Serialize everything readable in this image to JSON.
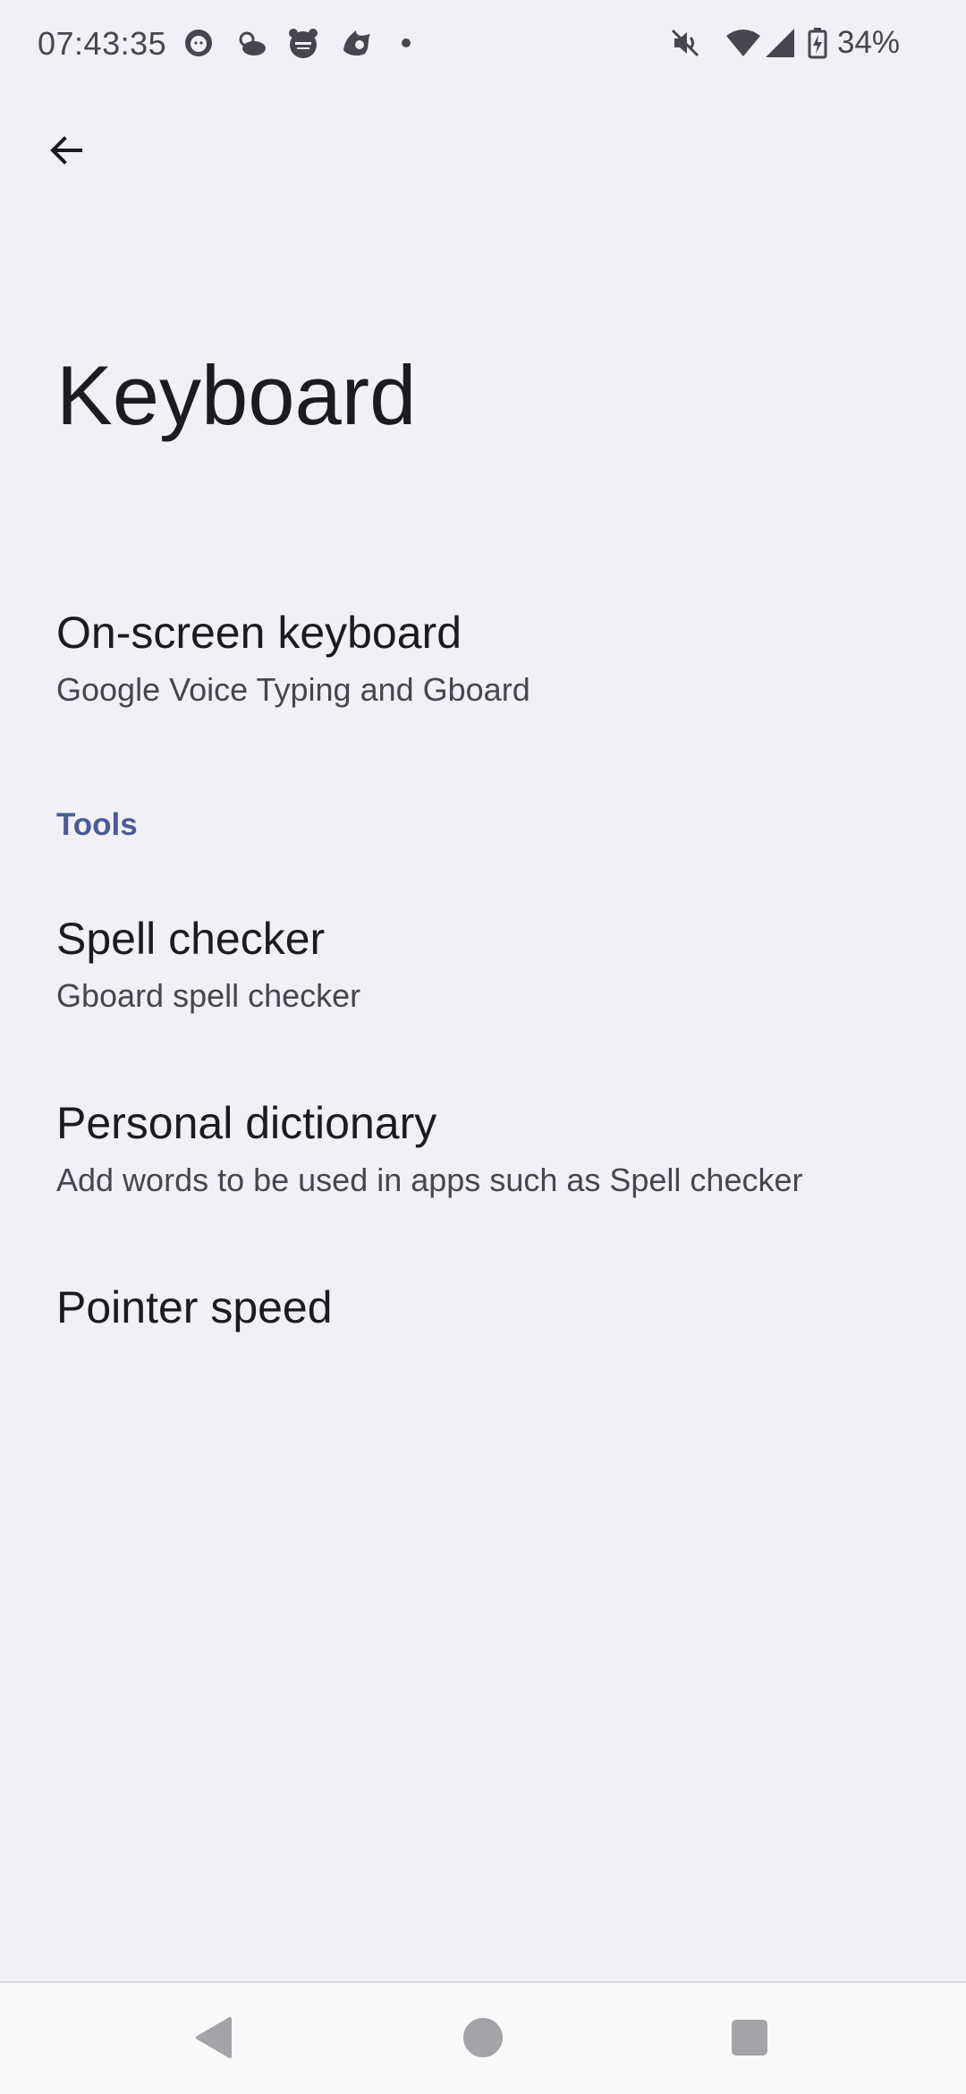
{
  "status_bar": {
    "time": "07:43:35",
    "battery_percent": "34%",
    "icons": [
      "notification-app-icon",
      "weather-icon",
      "notification-app-icon",
      "notification-app-icon",
      "more-notifications-dot-icon",
      "mute-icon",
      "wifi-icon",
      "signal-icon",
      "battery-charging-icon"
    ]
  },
  "header": {
    "back_icon": "arrow-back-icon",
    "title": "Keyboard"
  },
  "items": {
    "on_screen_keyboard": {
      "title": "On-screen keyboard",
      "summary": "Google Voice Typing and Gboard"
    },
    "tools_header": "Tools",
    "spell_checker": {
      "title": "Spell checker",
      "summary": "Gboard spell checker"
    },
    "personal_dictionary": {
      "title": "Personal dictionary",
      "summary": "Add words to be used in apps such as Spell checker"
    },
    "pointer_speed": {
      "title": "Pointer speed"
    }
  },
  "nav_bar": {
    "icons": [
      "nav-back-icon",
      "nav-home-icon",
      "nav-recents-icon"
    ]
  },
  "colors": {
    "background": "#f1f0f6",
    "accent": "#4c5c92",
    "text_primary": "#1b1b21",
    "text_secondary": "#46464e"
  }
}
